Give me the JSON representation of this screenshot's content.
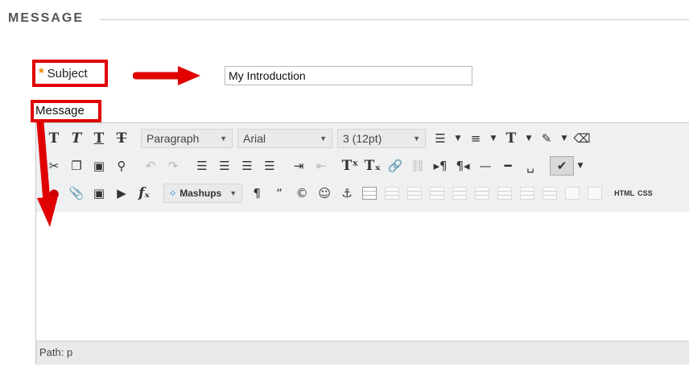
{
  "section": {
    "title": "MESSAGE"
  },
  "subject": {
    "label": "Subject",
    "required_mark": "*",
    "value": "My Introduction"
  },
  "message": {
    "label": "Message"
  },
  "toolbar": {
    "format_select": "Paragraph",
    "font_select": "Arial",
    "size_select": "3 (12pt)",
    "mashups": "Mashups",
    "html_label": "HTML",
    "css_label": "CSS"
  },
  "path_bar": {
    "text": "Path: p"
  },
  "colors": {
    "annotation": "#e00000",
    "required": "#f08a00",
    "toolbar_bg": "#eef0f2"
  }
}
